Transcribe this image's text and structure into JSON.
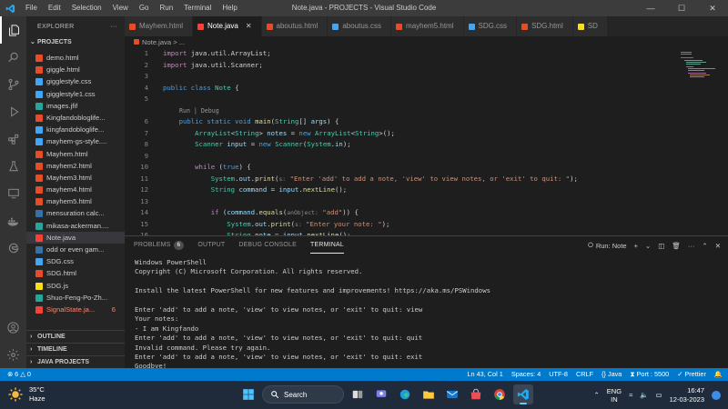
{
  "titlebar": {
    "menu": [
      "File",
      "Edit",
      "Selection",
      "View",
      "Go",
      "Run",
      "Terminal",
      "Help"
    ],
    "title": "Note.java - PROJECTS - Visual Studio Code"
  },
  "sidebar": {
    "header": "EXPLORER",
    "section": "PROJECTS",
    "files": [
      {
        "name": "demo.html",
        "type": "html"
      },
      {
        "name": "giggle.html",
        "type": "html"
      },
      {
        "name": "gigglestyle.css",
        "type": "css"
      },
      {
        "name": "gigglestyle1.css",
        "type": "css"
      },
      {
        "name": "images.jfif",
        "type": "img"
      },
      {
        "name": "Kingfandobloglife...",
        "type": "html"
      },
      {
        "name": "kingfandobloglife...",
        "type": "css"
      },
      {
        "name": "mayhem-gs-style....",
        "type": "css"
      },
      {
        "name": "Mayhem.html",
        "type": "html"
      },
      {
        "name": "mayhem2.html",
        "type": "html"
      },
      {
        "name": "Mayhem3.html",
        "type": "html"
      },
      {
        "name": "mayhem4.html",
        "type": "html"
      },
      {
        "name": "mayhem5.html",
        "type": "html"
      },
      {
        "name": "mensuration calc...",
        "type": "py"
      },
      {
        "name": "mikasa-ackerman....",
        "type": "img"
      },
      {
        "name": "Note.java",
        "type": "java"
      },
      {
        "name": "odd or even gam...",
        "type": "py"
      },
      {
        "name": "SDG.css",
        "type": "css"
      },
      {
        "name": "SDG.html",
        "type": "html"
      },
      {
        "name": "SDG.js",
        "type": "js"
      },
      {
        "name": "Shuo-Feng-Po-Zh...",
        "type": "img"
      },
      {
        "name": "SignalState.ja...",
        "type": "java",
        "badge": "6"
      }
    ],
    "bottom_sections": [
      "OUTLINE",
      "TIMELINE",
      "JAVA PROJECTS"
    ]
  },
  "tabs": [
    {
      "label": "Mayhem.html",
      "type": "html"
    },
    {
      "label": "Note.java",
      "type": "java"
    },
    {
      "label": "aboutus.html",
      "type": "html"
    },
    {
      "label": "aboutus.css",
      "type": "css"
    },
    {
      "label": "mayhem5.html",
      "type": "html"
    },
    {
      "label": "SDG.css",
      "type": "css"
    },
    {
      "label": "SDG.html",
      "type": "html"
    },
    {
      "label": "SD",
      "type": "js"
    }
  ],
  "breadcrumb": {
    "file": "Note.java",
    "rest": " > ..."
  },
  "editor": {
    "codelens": "Run | Debug",
    "lines": [
      {
        "n": "1",
        "html": "<span class=\"kc\">import</span> java.util.ArrayList;"
      },
      {
        "n": "2",
        "html": "<span class=\"kc\">import</span> java.util.Scanner;"
      },
      {
        "n": "3",
        "html": ""
      },
      {
        "n": "4",
        "html": "<span class=\"k\">public class</span> <span class=\"t\">Note</span> {"
      },
      {
        "n": "5",
        "html": ""
      },
      {
        "n": "6",
        "html": "    <span class=\"k\">public static void</span> <span class=\"f\">main</span>(<span class=\"t\">String</span>[] <span class=\"v\">args</span>) {"
      },
      {
        "n": "7",
        "html": "        <span class=\"t\">ArrayList</span>&lt;<span class=\"t\">String</span>&gt; <span class=\"v\">notes</span> = <span class=\"k\">new</span> <span class=\"t\">ArrayList</span>&lt;<span class=\"t\">String</span>&gt;();"
      },
      {
        "n": "8",
        "html": "        <span class=\"t\">Scanner</span> <span class=\"v\">input</span> = <span class=\"k\">new</span> <span class=\"t\">Scanner</span>(<span class=\"t\">System</span>.<span class=\"v\">in</span>);"
      },
      {
        "n": "9",
        "html": ""
      },
      {
        "n": "10",
        "html": "        <span class=\"kc\">while</span> (<span class=\"k\">true</span>) {"
      },
      {
        "n": "11",
        "html": "            <span class=\"t\">System</span>.<span class=\"v\">out</span>.<span class=\"f\">print</span>(<span class=\"h\">s:</span> <span class=\"s\">\"Enter 'add' to add a note, 'view' to view notes, or 'exit' to quit: \"</span>);"
      },
      {
        "n": "12",
        "html": "            <span class=\"t\">String</span> <span class=\"v\">command</span> = <span class=\"v\">input</span>.<span class=\"f\">nextLine</span>();"
      },
      {
        "n": "13",
        "html": ""
      },
      {
        "n": "14",
        "html": "            <span class=\"kc\">if</span> (<span class=\"v\">command</span>.<span class=\"f\">equals</span>(<span class=\"h\">anObject:</span> <span class=\"s\">\"add\"</span>)) {"
      },
      {
        "n": "15",
        "html": "                <span class=\"t\">System</span>.<span class=\"v\">out</span>.<span class=\"f\">print</span>(<span class=\"h\">s:</span> <span class=\"s\">\"Enter your note: \"</span>);"
      },
      {
        "n": "16",
        "html": "                <span class=\"t\">String</span> <span class=\"v\">note</span> = <span class=\"v\">input</span>.<span class=\"f\">nextLine</span>();"
      }
    ]
  },
  "panel": {
    "tabs": [
      "PROBLEMS",
      "OUTPUT",
      "DEBUG CONSOLE",
      "TERMINAL"
    ],
    "problems_count": "6",
    "run_label": "Run: Note",
    "terminal_lines": [
      "Windows PowerShell",
      "Copyright (C) Microsoft Corporation. All rights reserved.",
      "",
      "Install the latest PowerShell for new features and improvements! https://aka.ms/PSWindows",
      "",
      "Enter 'add' to add a note, 'view' to view notes, or 'exit' to quit: view",
      "Your notes:",
      "- I am Kingfando",
      "Enter 'add' to add a note, 'view' to view notes, or 'exit' to quit: quit",
      "Invalid command. Please try again.",
      "Enter 'add' to add a note, 'view' to view notes, or 'exit' to quit: exit",
      "Goodbye!"
    ]
  },
  "statusbar": {
    "errors": "6",
    "warnings": "0",
    "position": "Ln 43, Col 1",
    "spaces": "Spaces: 4",
    "encoding": "UTF-8",
    "eol": "CRLF",
    "language": "Java",
    "port": "Port : 5500",
    "prettier": "Prettier"
  },
  "taskbar": {
    "temperature": "35°C",
    "weather": "Haze",
    "search": "Search",
    "lang_top": "ENG",
    "lang_bottom": "IN",
    "time": "16:47",
    "date": "12-03-2023"
  },
  "colors": {
    "accent": "#007acc",
    "titlebar": "#3c3c3c",
    "activity": "#333333",
    "sidebar": "#252526",
    "editor": "#1e1e1e"
  }
}
